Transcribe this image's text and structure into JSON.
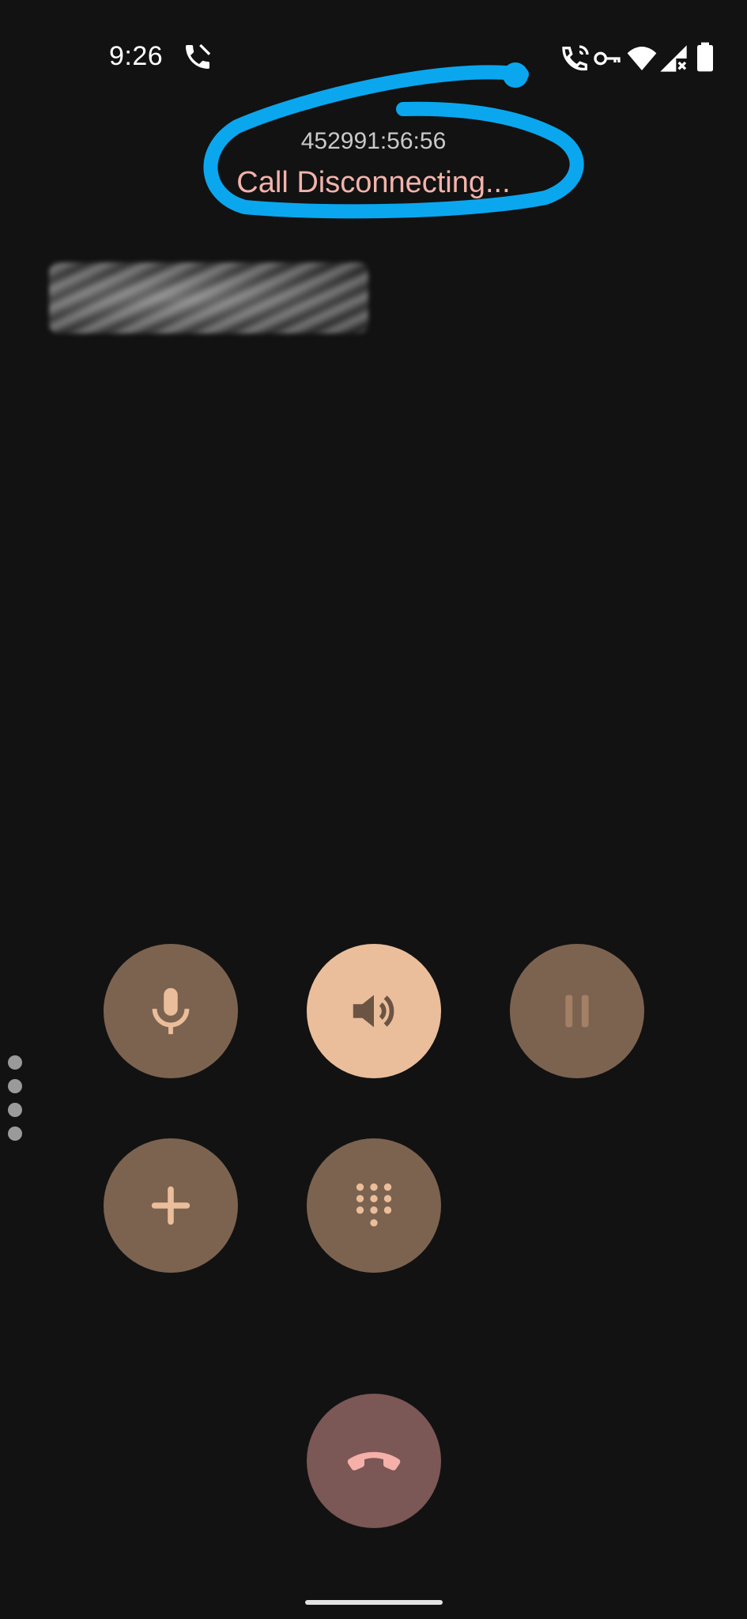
{
  "status_bar": {
    "time": "9:26",
    "icons": [
      "phone-call-icon",
      "wifi-calling-icon",
      "vpn-key-icon",
      "wifi-icon",
      "signal-no-service-icon",
      "battery-icon"
    ]
  },
  "call": {
    "timer": "452991:56:56",
    "status": "Call Disconnecting...",
    "caller_name": ""
  },
  "controls": {
    "mute": "mic-icon",
    "speaker": "speaker-icon",
    "hold": "pause-icon",
    "add_call": "add-icon",
    "keypad": "dialpad-icon",
    "end_call": "hang-up-icon"
  },
  "colors": {
    "background": "#121212",
    "button_dim": "#7c6350",
    "button_active": "#ebbe9b",
    "end_call": "#7b5756",
    "status_text": "#f3b3ab",
    "annotation": "#0aa7ef"
  }
}
